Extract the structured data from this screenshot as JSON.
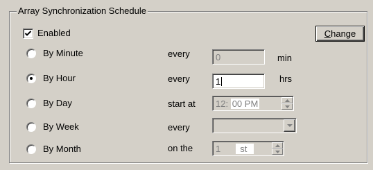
{
  "groupbox": {
    "title": "Array Synchronization Schedule"
  },
  "enabled": {
    "label": "Enabled",
    "checked": true
  },
  "change_button": {
    "label_mnemonic": "C",
    "label_rest": "hange"
  },
  "options": [
    {
      "label": "By Minute",
      "selected": false,
      "param_label": "every",
      "value": "0",
      "unit": "min"
    },
    {
      "label": "By Hour",
      "selected": true,
      "param_label": "every",
      "value": "1",
      "unit": "hrs"
    },
    {
      "label": "By Day",
      "selected": false,
      "param_label": "start at",
      "hour": "12",
      "minute": "00",
      "ampm": "PM"
    },
    {
      "label": "By Week",
      "selected": false,
      "param_label": "every",
      "value": ""
    },
    {
      "label": "By Month",
      "selected": false,
      "param_label": "on the",
      "value": "1",
      "suffix": "st"
    }
  ]
}
